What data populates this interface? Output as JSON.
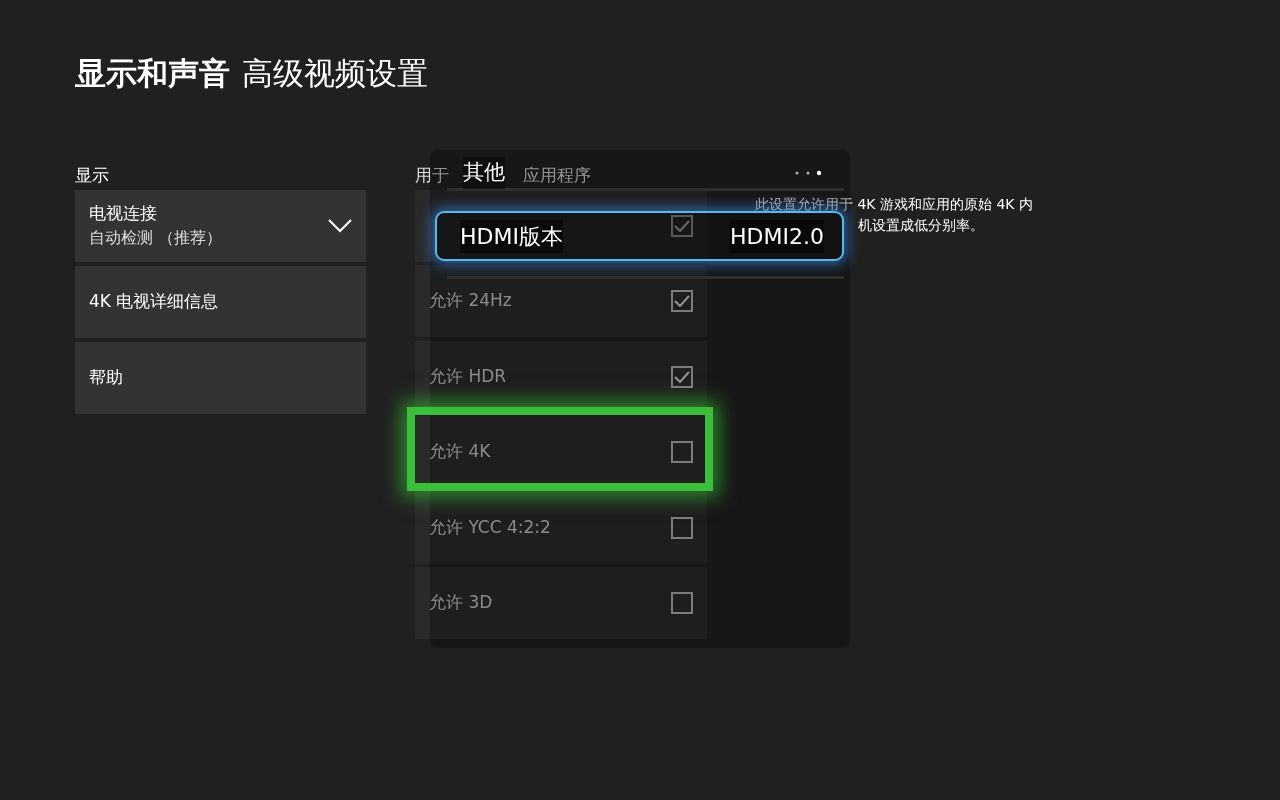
{
  "title": {
    "section": "显示和声音",
    "page": "高级视频设置"
  },
  "left": {
    "heading": "显示",
    "items": [
      {
        "kind": "dropdown",
        "label": "电视连接",
        "value": "自动检测 （推荐）"
      },
      {
        "kind": "link",
        "label": "4K 电视详细信息"
      },
      {
        "kind": "link",
        "label": "帮助"
      }
    ]
  },
  "middle": {
    "heading_parts": [
      "用于",
      "应用程序"
    ],
    "rows": [
      {
        "checked": true,
        "focused": false
      },
      {
        "label": "允许 24Hz",
        "checked": true,
        "focused": false
      },
      {
        "label": "允许 HDR",
        "checked": true,
        "focused": false
      },
      {
        "label": "允许 4K",
        "checked": false,
        "focused": true
      },
      {
        "label": "允许 YCC 4:2:2",
        "checked": false,
        "focused": false
      },
      {
        "label": "允许 3D",
        "checked": false,
        "focused": false
      }
    ]
  },
  "description": {
    "lines": [
      "此设置允许用于 4K 游戏和应用的原始 4K 内",
      "机设置成低分别率。"
    ]
  },
  "overlay": {
    "title": "其他",
    "items": [
      {
        "label": "HDMI版本",
        "value": "HDMI2.0",
        "focused": true
      }
    ]
  }
}
